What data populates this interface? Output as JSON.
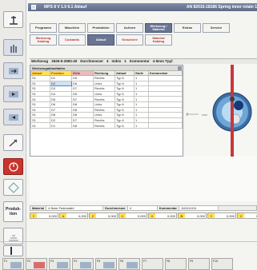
{
  "titlebar": {
    "left": "MPS 8 V 1.0   6.1 Ablauf",
    "right": "AN 82015-18186   Spring inner retain   1"
  },
  "tabs_row1": [
    "Programm",
    "Maschine",
    "Produktion",
    "Achsen",
    "Werkzeug / Material",
    "Extras",
    "Service"
  ],
  "tabs_row2": [
    "Werkzeug Katalog",
    "Costantis",
    "Ablauf",
    "Kinschere",
    "Material Katalog"
  ],
  "active_tab": "Ablauf",
  "header": {
    "tool_label": "Werkzeug",
    "tool_value": "2626-5-2983-40",
    "diameter_label": "Durchmesser",
    "diameter_value": "4",
    "index_label": "Index",
    "index_value": "1",
    "comment_label": "Kommentar",
    "comment_value": "4 8mm Tpyl"
  },
  "panel_title": "Werkzeugablaufdaten",
  "table": {
    "columns": [
      "Ablauf",
      "Position",
      "Ziele",
      "Richtung",
      "Ablauf",
      "Stufe",
      "Kommentar"
    ],
    "rows": [
      [
        "S1",
        "D1",
        "D5",
        "Rechts",
        "Typ  6",
        "1",
        ""
      ],
      [
        "S1",
        "D2",
        "D6",
        "Links",
        "Typ  6",
        "1",
        ""
      ],
      [
        "S1",
        "D3",
        "D7",
        "Rechts",
        "Typ  6",
        "1",
        ""
      ],
      [
        "S1",
        "D4",
        "D5",
        "Links",
        "Typ  6",
        "1",
        ""
      ],
      [
        "S1",
        "D5",
        "D7",
        "Rechts",
        "Typ  6",
        "1",
        ""
      ],
      [
        "S1",
        "D6",
        "D8",
        "Links",
        "Typ  6",
        "1",
        ""
      ],
      [
        "S1",
        "D7",
        "D8",
        "Rechts",
        "Typ  6",
        "1",
        ""
      ],
      [
        "S1",
        "D8",
        "D6",
        "Links",
        "Typ  6",
        "1",
        ""
      ],
      [
        "S1",
        "D2",
        "D7",
        "Rechts",
        "Typ  6",
        "1",
        ""
      ],
      [
        "S1",
        "D1",
        "D8",
        "Rechts",
        "Typ  6",
        "1",
        ""
      ]
    ]
  },
  "material": {
    "label": "Material",
    "value": "4 8mm Federstahl",
    "diameter_label": "Durchmesser",
    "diameter_value": "4",
    "comment_label": "Kommentar",
    "comment_value": "1111111111"
  },
  "coords": [
    {
      "axis": "Y",
      "value": "0,000"
    },
    {
      "axis": "A",
      "value": "0,000"
    },
    {
      "axis": "Z",
      "value": "0,000"
    },
    {
      "axis": "C",
      "value": "0,000"
    },
    {
      "axis": "X",
      "value": "0,000"
    },
    {
      "axis": "B",
      "value": "0,000"
    },
    {
      "axis": "Y",
      "value": "0,000"
    },
    {
      "axis": "V",
      "value": "0,000"
    }
  ],
  "left_toolbar_text": "Produk-tion",
  "fkeys": [
    "F1",
    "F2",
    "F3",
    "F4",
    "F5",
    "F6",
    "F7",
    "F8",
    "F9",
    "F10"
  ],
  "colors": {
    "accent": "#6a7593",
    "highlight": "#ffe44a",
    "stop_red": "#c9342c"
  }
}
